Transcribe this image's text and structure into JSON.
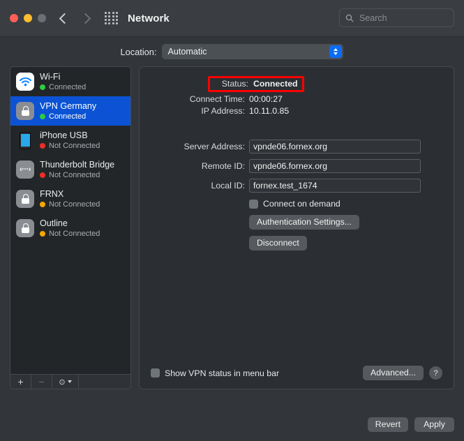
{
  "window": {
    "title": "Network",
    "traffic_lights": [
      "close",
      "minimize",
      "zoom"
    ],
    "search_placeholder": "Search",
    "search_value": ""
  },
  "location": {
    "label": "Location:",
    "selected": "Automatic",
    "options": [
      "Automatic"
    ]
  },
  "sidebar": {
    "services": [
      {
        "name": "Wi-Fi",
        "status": "Connected",
        "status_color": "green",
        "icon": "wifi-icon",
        "selected": false
      },
      {
        "name": "VPN Germany",
        "status": "Connected",
        "status_color": "green",
        "icon": "lock-icon",
        "selected": true
      },
      {
        "name": "iPhone USB",
        "status": "Not Connected",
        "status_color": "red",
        "icon": "iphone-icon",
        "selected": false
      },
      {
        "name": "Thunderbolt Bridge",
        "status": "Not Connected",
        "status_color": "red",
        "icon": "thunderbolt-icon",
        "selected": false
      },
      {
        "name": "FRNX",
        "status": "Not Connected",
        "status_color": "amber",
        "icon": "lock-icon",
        "selected": false
      },
      {
        "name": "Outline",
        "status": "Not Connected",
        "status_color": "amber",
        "icon": "lock-icon",
        "selected": false
      }
    ],
    "toolbar": {
      "add": "+",
      "remove": "−",
      "action": "⊙"
    }
  },
  "main": {
    "status": {
      "label": "Status:",
      "value": "Connected",
      "highlight_color": "#ff0000"
    },
    "connect_time": {
      "label": "Connect Time:",
      "value": "00:00:27"
    },
    "ip_address": {
      "label": "IP Address:",
      "value": "10.11.0.85"
    },
    "server_address": {
      "label": "Server Address:",
      "value": "vpnde06.fornex.org"
    },
    "remote_id": {
      "label": "Remote ID:",
      "value": "vpnde06.fornex.org"
    },
    "local_id": {
      "label": "Local ID:",
      "value": "fornex.test_1674"
    },
    "connect_on_demand": {
      "label": "Connect on demand",
      "checked": false
    },
    "auth_settings_button": "Authentication Settings...",
    "disconnect_button": "Disconnect",
    "show_status_menu_bar": {
      "label": "Show VPN status in menu bar",
      "checked": false
    },
    "advanced_button": "Advanced...",
    "help_button": "?"
  },
  "footer": {
    "revert_button": "Revert",
    "apply_button": "Apply"
  }
}
